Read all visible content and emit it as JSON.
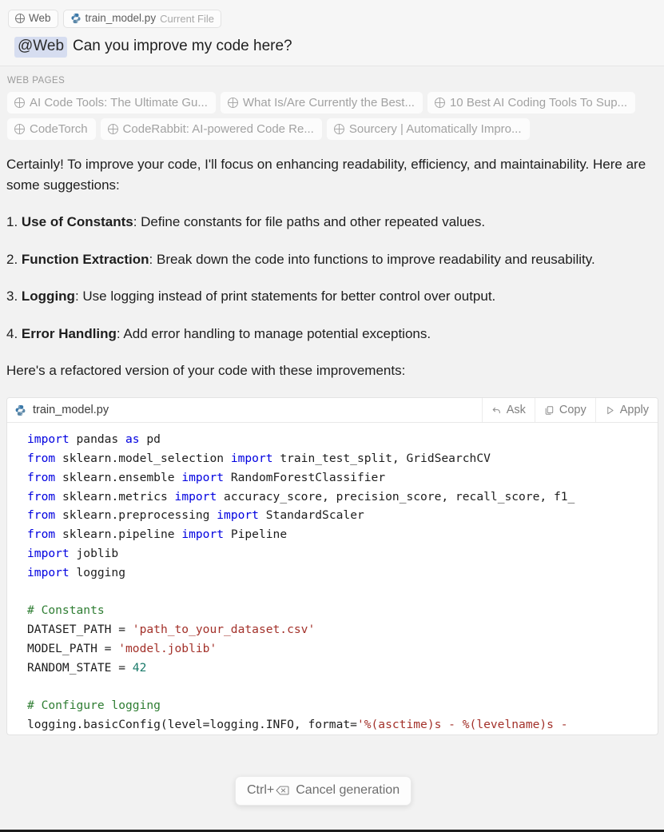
{
  "composer": {
    "context_chips": [
      {
        "icon": "globe-icon",
        "label": "Web",
        "sub": ""
      },
      {
        "icon": "python-file-icon",
        "label": "train_model.py",
        "sub": "Current File"
      }
    ],
    "mention": "@Web",
    "prompt_text": "Can you improve my code here?"
  },
  "web_pages": {
    "section_label": "WEB PAGES",
    "chips": [
      {
        "icon": "globe-icon",
        "label": "AI Code Tools: The Ultimate Gu..."
      },
      {
        "icon": "globe-icon",
        "label": "What Is/Are Currently the Best..."
      },
      {
        "icon": "globe-icon",
        "label": "10 Best AI Coding Tools To Sup..."
      },
      {
        "icon": "globe-icon",
        "label": "CodeTorch"
      },
      {
        "icon": "globe-icon",
        "label": "CodeRabbit: AI-powered Code Re..."
      },
      {
        "icon": "globe-icon",
        "label": "Sourcery | Automatically Impro..."
      }
    ]
  },
  "answer": {
    "intro": "Certainly! To improve your code, I'll focus on enhancing readability, efficiency, and maintainability. Here are some suggestions:",
    "items": [
      {
        "number": "1.",
        "title": "Use of Constants",
        "body": ": Define constants for file paths and other repeated values."
      },
      {
        "number": "2.",
        "title": "Function Extraction",
        "body": ": Break down the code into functions to improve readability and reusability."
      },
      {
        "number": "3.",
        "title": "Logging",
        "body": ": Use logging instead of print statements for better control over output."
      },
      {
        "number": "4.",
        "title": "Error Handling",
        "body": ": Add error handling to manage potential exceptions."
      }
    ],
    "outro": "Here's a refactored version of your code with these improvements:"
  },
  "code_block": {
    "filename": "train_model.py",
    "file_icon": "python-icon",
    "actions": [
      {
        "icon": "undo-arrow-icon",
        "label": "Ask"
      },
      {
        "icon": "copy-icon",
        "label": "Copy"
      },
      {
        "icon": "play-triangle-icon",
        "label": "Apply"
      }
    ],
    "language": "python",
    "lines": [
      [
        {
          "t": "import",
          "c": "kw"
        },
        {
          "t": " pandas ",
          "c": ""
        },
        {
          "t": "as",
          "c": "kw"
        },
        {
          "t": " pd",
          "c": ""
        }
      ],
      [
        {
          "t": "from",
          "c": "kw"
        },
        {
          "t": " sklearn.model_selection ",
          "c": ""
        },
        {
          "t": "import",
          "c": "kw"
        },
        {
          "t": " train_test_split, GridSearchCV",
          "c": ""
        }
      ],
      [
        {
          "t": "from",
          "c": "kw"
        },
        {
          "t": " sklearn.ensemble ",
          "c": ""
        },
        {
          "t": "import",
          "c": "kw"
        },
        {
          "t": " RandomForestClassifier",
          "c": ""
        }
      ],
      [
        {
          "t": "from",
          "c": "kw"
        },
        {
          "t": " sklearn.metrics ",
          "c": ""
        },
        {
          "t": "import",
          "c": "kw"
        },
        {
          "t": " accuracy_score, precision_score, recall_score, f1_",
          "c": ""
        }
      ],
      [
        {
          "t": "from",
          "c": "kw"
        },
        {
          "t": " sklearn.preprocessing ",
          "c": ""
        },
        {
          "t": "import",
          "c": "kw"
        },
        {
          "t": " StandardScaler",
          "c": ""
        }
      ],
      [
        {
          "t": "from",
          "c": "kw"
        },
        {
          "t": " sklearn.pipeline ",
          "c": ""
        },
        {
          "t": "import",
          "c": "kw"
        },
        {
          "t": " Pipeline",
          "c": ""
        }
      ],
      [
        {
          "t": "import",
          "c": "kw"
        },
        {
          "t": " joblib",
          "c": ""
        }
      ],
      [
        {
          "t": "import",
          "c": "kw"
        },
        {
          "t": " logging",
          "c": ""
        }
      ],
      [
        {
          "t": "",
          "c": ""
        }
      ],
      [
        {
          "t": "# Constants",
          "c": "cm"
        }
      ],
      [
        {
          "t": "DATASET_PATH = ",
          "c": ""
        },
        {
          "t": "'path_to_your_dataset.csv'",
          "c": "st"
        }
      ],
      [
        {
          "t": "MODEL_PATH = ",
          "c": ""
        },
        {
          "t": "'model.joblib'",
          "c": "st"
        }
      ],
      [
        {
          "t": "RANDOM_STATE = ",
          "c": ""
        },
        {
          "t": "42",
          "c": "nu"
        }
      ],
      [
        {
          "t": "",
          "c": ""
        }
      ],
      [
        {
          "t": "# Configure logging",
          "c": "cm"
        }
      ],
      [
        {
          "t": "logging.basicConfig(level=logging.INFO, format=",
          "c": ""
        },
        {
          "t": "'%(asctime)s - %(levelname)s - ",
          "c": "st"
        }
      ]
    ]
  },
  "cancel_toast": {
    "shortcut_prefix": "Ctrl+",
    "shortcut_key_icon": "backspace-icon",
    "label": "Cancel generation"
  },
  "colors": {
    "page_background": "#f2f2f2",
    "composer_background": "#f6f6f6",
    "mention_highlight": "#d6ddf0",
    "chip_background": "#fcfcfc",
    "code_background": "#ffffff",
    "keyword": "#0000e0",
    "comment": "#2e7d32",
    "string": "#a3312a",
    "number": "#1a7a6a",
    "muted_text": "#a2a2a2"
  }
}
